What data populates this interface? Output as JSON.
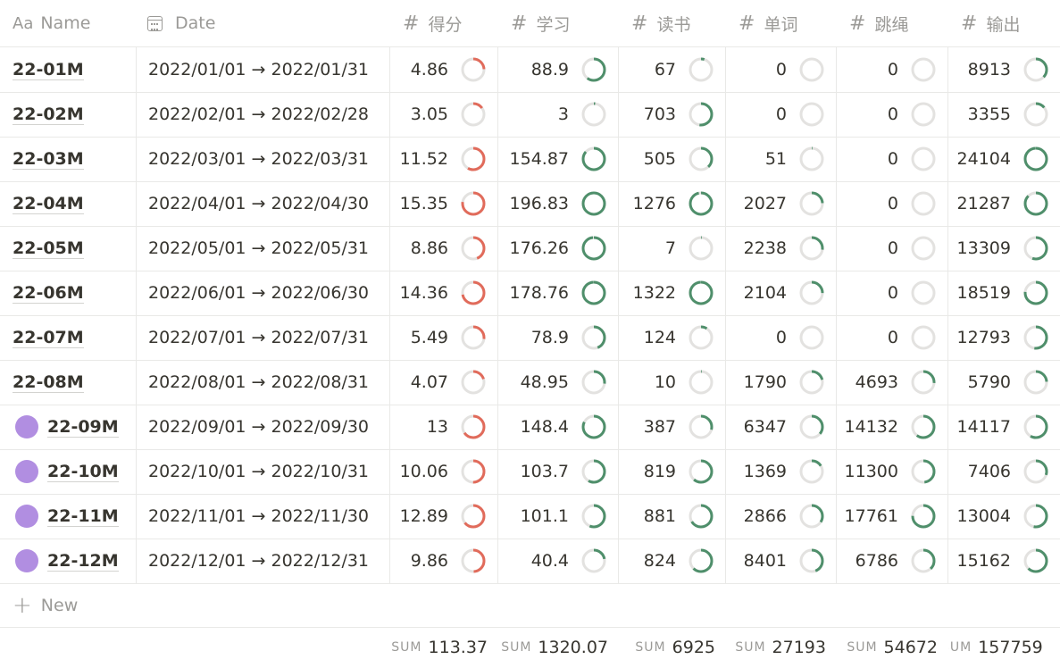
{
  "headers": {
    "name_prefix": "Aa",
    "name": "Name",
    "date": "Date",
    "hash": "#",
    "columns": [
      "得分",
      "学习",
      "读书",
      "单词",
      "跳绳",
      "输出"
    ]
  },
  "colors": {
    "red_ring": "#e16b5b",
    "green_ring": "#4f8f6b",
    "track": "#e3e2e0",
    "dot": "#b18ee1"
  },
  "rows": [
    {
      "name": "22-01M",
      "date": "2022/01/01 → 2022/01/31",
      "dot": false,
      "values": [
        "4.86",
        "88.9",
        "67",
        "0",
        "0",
        "8913"
      ],
      "fill": [
        0.24,
        0.6,
        0.05,
        0,
        0,
        0.37
      ]
    },
    {
      "name": "22-02M",
      "date": "2022/02/01 → 2022/02/28",
      "dot": false,
      "values": [
        "3.05",
        "3",
        "703",
        "0",
        "0",
        "3355"
      ],
      "fill": [
        0.15,
        0.02,
        0.52,
        0,
        0,
        0.14
      ]
    },
    {
      "name": "22-03M",
      "date": "2022/03/01 → 2022/03/31",
      "dot": false,
      "values": [
        "11.52",
        "154.87",
        "505",
        "51",
        "0",
        "24104"
      ],
      "fill": [
        0.58,
        0.86,
        0.38,
        0.01,
        0,
        0.99
      ]
    },
    {
      "name": "22-04M",
      "date": "2022/04/01 → 2022/04/30",
      "dot": false,
      "values": [
        "15.35",
        "196.83",
        "1276",
        "2027",
        "0",
        "21287"
      ],
      "fill": [
        0.77,
        1.0,
        0.96,
        0.24,
        0,
        0.87
      ]
    },
    {
      "name": "22-05M",
      "date": "2022/05/01 → 2022/05/31",
      "dot": false,
      "values": [
        "8.86",
        "176.26",
        "7",
        "2238",
        "0",
        "13309"
      ],
      "fill": [
        0.44,
        0.98,
        0.01,
        0.27,
        0,
        0.55
      ]
    },
    {
      "name": "22-06M",
      "date": "2022/06/01 → 2022/06/30",
      "dot": false,
      "values": [
        "14.36",
        "178.76",
        "1322",
        "2104",
        "0",
        "18519"
      ],
      "fill": [
        0.72,
        0.99,
        0.99,
        0.25,
        0,
        0.76
      ]
    },
    {
      "name": "22-07M",
      "date": "2022/07/01 → 2022/07/31",
      "dot": false,
      "values": [
        "5.49",
        "78.9",
        "124",
        "0",
        "0",
        "12793"
      ],
      "fill": [
        0.27,
        0.44,
        0.09,
        0,
        0,
        0.52
      ]
    },
    {
      "name": "22-08M",
      "date": "2022/08/01 → 2022/08/31",
      "dot": false,
      "values": [
        "4.07",
        "48.95",
        "10",
        "1790",
        "4693",
        "5790"
      ],
      "fill": [
        0.2,
        0.27,
        0.01,
        0.21,
        0.26,
        0.24
      ]
    },
    {
      "name": "22-09M",
      "date": "2022/09/01 → 2022/09/30",
      "dot": true,
      "values": [
        "13",
        "148.4",
        "387",
        "6347",
        "14132",
        "14117"
      ],
      "fill": [
        0.65,
        0.82,
        0.29,
        0.36,
        0.6,
        0.58
      ]
    },
    {
      "name": "22-10M",
      "date": "2022/10/01 → 2022/10/31",
      "dot": true,
      "values": [
        "10.06",
        "103.7",
        "819",
        "1369",
        "11300",
        "7406"
      ],
      "fill": [
        0.5,
        0.58,
        0.61,
        0.16,
        0.48,
        0.3
      ]
    },
    {
      "name": "22-11M",
      "date": "2022/11/01 → 2022/11/30",
      "dot": true,
      "values": [
        "12.89",
        "101.1",
        "881",
        "2866",
        "17761",
        "13004"
      ],
      "fill": [
        0.64,
        0.56,
        0.66,
        0.34,
        0.75,
        0.53
      ]
    },
    {
      "name": "22-12M",
      "date": "2022/12/01 → 2022/12/31",
      "dot": true,
      "values": [
        "9.86",
        "40.4",
        "824",
        "8401",
        "6786",
        "15162"
      ],
      "fill": [
        0.49,
        0.22,
        0.62,
        0.44,
        0.38,
        0.62
      ]
    }
  ],
  "new_label": "New",
  "sums": {
    "label": "SUM",
    "values": [
      "113.37",
      "1320.07",
      "6925",
      "27193",
      "54672",
      "157759"
    ]
  }
}
